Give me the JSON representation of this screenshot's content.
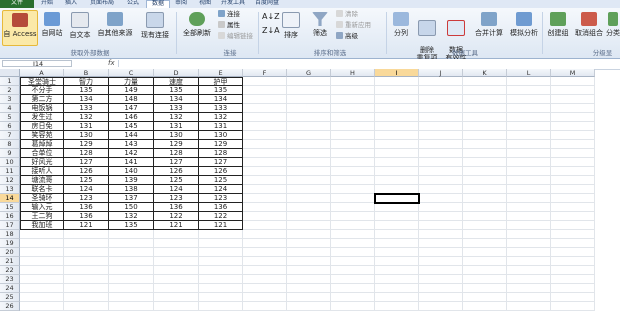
{
  "ribbon": {
    "tabs": [
      "文件",
      "开始",
      "插入",
      "页面布局",
      "公式",
      "数据",
      "审阅",
      "视图",
      "开发工具",
      "百度网盘"
    ],
    "buttons": {
      "access": "自 Access",
      "web": "自网站",
      "text": "自文本",
      "other": "自其他来源",
      "existing": "现有连接",
      "refresh_all": "全部刷新",
      "connections": "连接",
      "properties": "属性",
      "edit_links": "编辑链接",
      "sort": "排序",
      "filter": "筛选",
      "clear": "清除",
      "reapply": "重新应用",
      "advanced": "高级",
      "text_to_columns": "分列",
      "remove_dup": "删除\n重复项",
      "validation": "数据\n有效性",
      "consolidate": "合并计算",
      "whatif": "模拟分析",
      "group": "创建组",
      "ungroup": "取消组合",
      "subtotal": "分类"
    },
    "groups": {
      "get_external": "获取外部数据",
      "connections": "连接",
      "sort_filter": "排序和筛选",
      "data_tools": "数据工具",
      "outline": "分级显"
    }
  },
  "formula_bar": {
    "name_box": "I14",
    "fx": "fx",
    "value": ""
  },
  "sheet": {
    "columns": [
      "A",
      "B",
      "C",
      "D",
      "E",
      "F",
      "G",
      "H",
      "I",
      "J",
      "K",
      "L",
      "M"
    ],
    "selected_column": "I",
    "selected_row": 14,
    "row_count": 26,
    "headers": [
      "圣堂骑士",
      "智力",
      "力量",
      "速度",
      "护甲"
    ],
    "rows": [
      [
        "不分手",
        "135",
        "149",
        "135",
        "135"
      ],
      [
        "第二方",
        "134",
        "148",
        "134",
        "134"
      ],
      [
        "电饭锅",
        "133",
        "147",
        "133",
        "133"
      ],
      [
        "发生过",
        "132",
        "146",
        "132",
        "132"
      ],
      [
        "房日免",
        "131",
        "145",
        "131",
        "131"
      ],
      [
        "笑容苑",
        "130",
        "144",
        "130",
        "130"
      ],
      [
        "葛焯焯",
        "129",
        "143",
        "129",
        "129"
      ],
      [
        "合单位",
        "128",
        "142",
        "128",
        "128"
      ],
      [
        "好风光",
        "127",
        "141",
        "127",
        "127"
      ],
      [
        "接听人",
        "126",
        "140",
        "126",
        "126"
      ],
      [
        "塘流哥",
        "125",
        "139",
        "125",
        "125"
      ],
      [
        "联名卡",
        "124",
        "138",
        "124",
        "124"
      ],
      [
        "圣骑环",
        "123",
        "137",
        "123",
        "123"
      ],
      [
        "输入元",
        "136",
        "150",
        "136",
        "136"
      ],
      [
        "王二狗",
        "136",
        "132",
        "122",
        "122"
      ],
      [
        "我加班",
        "121",
        "135",
        "121",
        "121"
      ]
    ]
  }
}
